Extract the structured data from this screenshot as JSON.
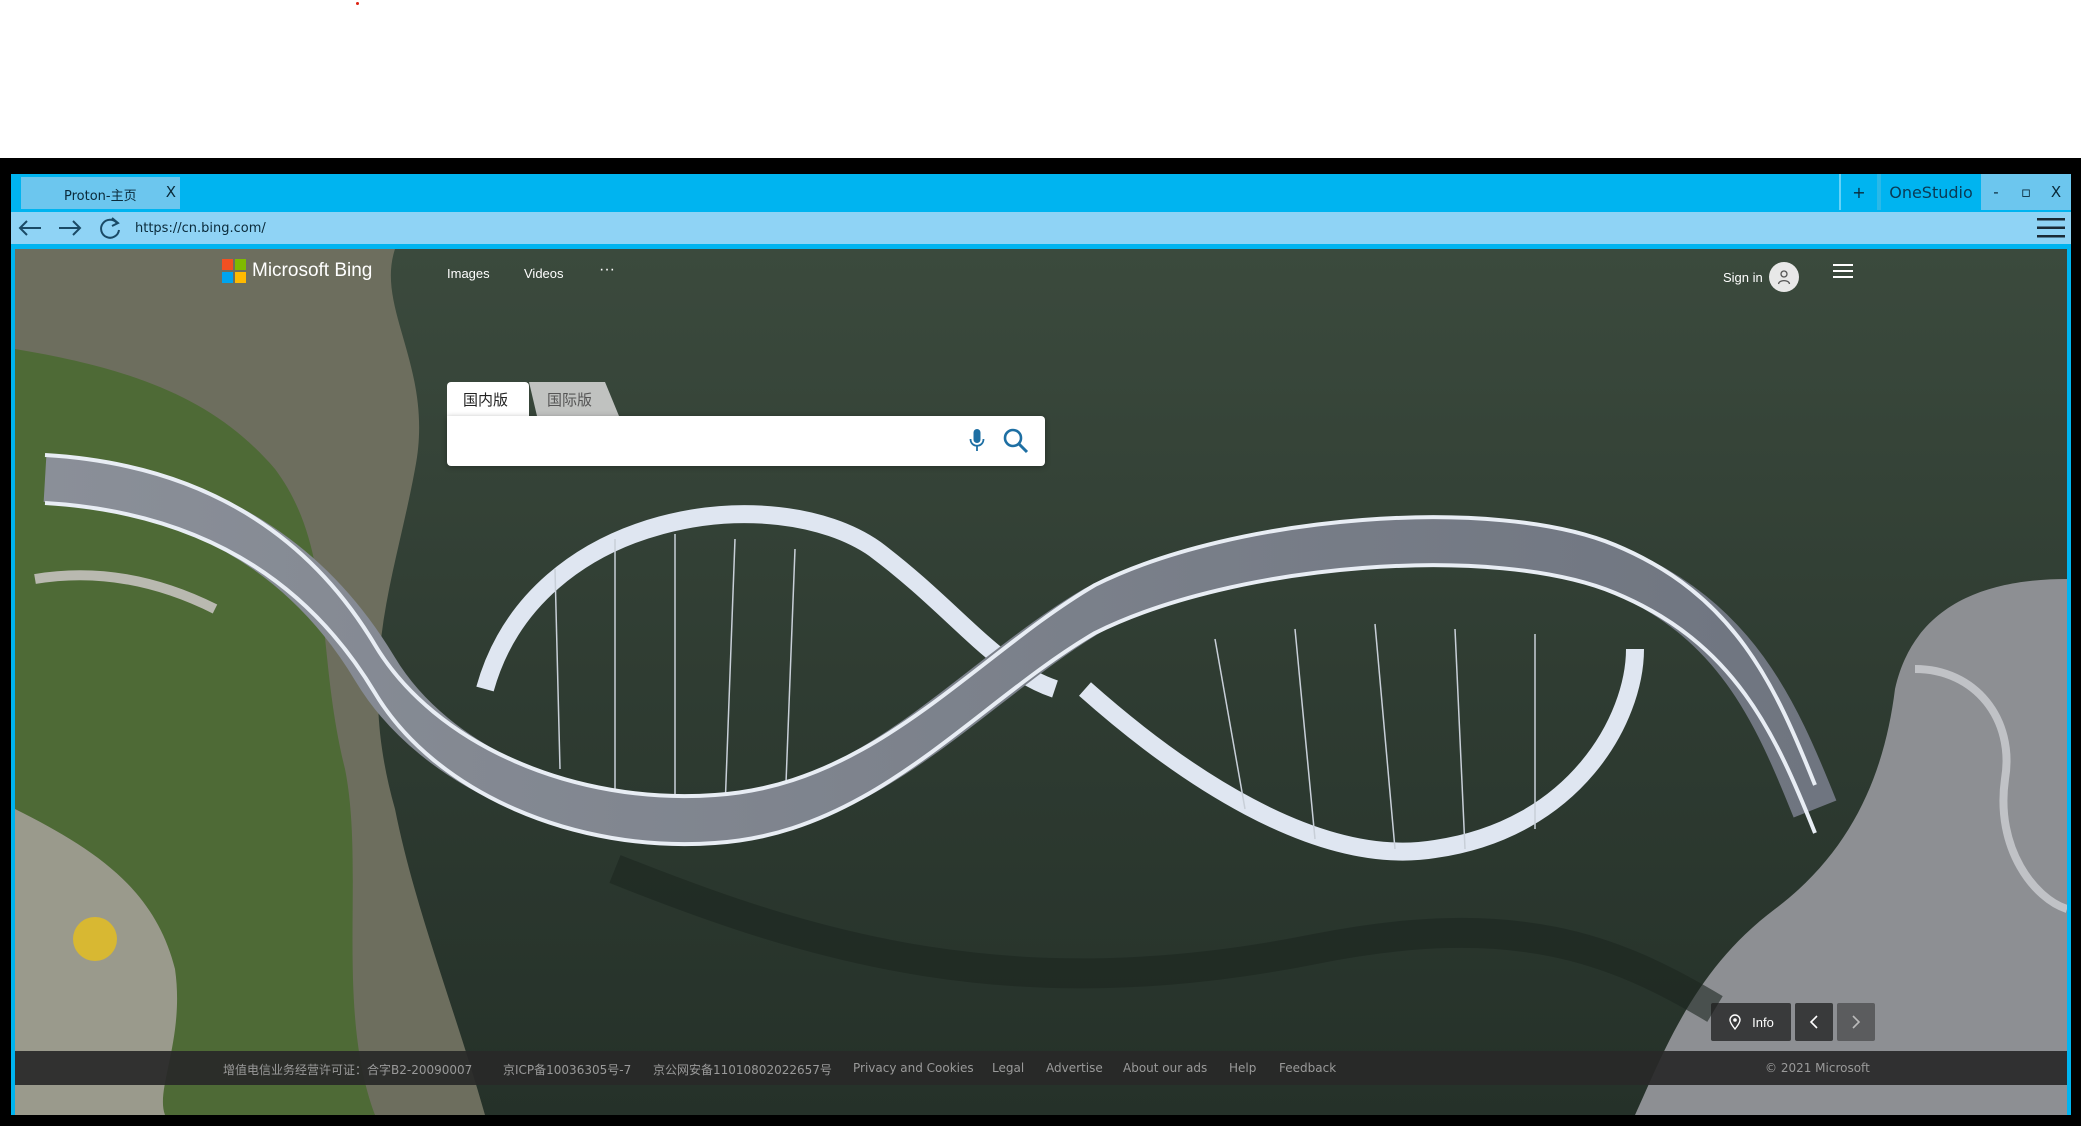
{
  "browser": {
    "tab_title": "Proton-主页",
    "tab_close": "X",
    "new_tab": "+",
    "brand": "OneStudio",
    "minimize": "-",
    "restore": "▫",
    "close": "X",
    "url": "https://cn.bing.com/"
  },
  "bing": {
    "logo_text": "Microsoft Bing",
    "nav": [
      "Images",
      "Videos",
      "···"
    ],
    "sign_in": "Sign in",
    "search_tabs": [
      "国内版",
      "国际版"
    ],
    "search_placeholder": "",
    "info": "Info"
  },
  "footer": {
    "links": [
      "增值电信业务经营许可证：合字B2-20090007",
      "京ICP备10036305号-7",
      "京公网安备11010802022657号",
      "Privacy and Cookies",
      "Legal",
      "Advertise",
      "About our ads",
      "Help",
      "Feedback"
    ],
    "copyright": "© 2021 Microsoft"
  },
  "colors": {
    "window_chrome": "#00b4f0",
    "address_bar": "#8fd3f5",
    "tab_active": "#6cc6ee"
  },
  "icons": [
    "back-arrow-icon",
    "forward-arrow-icon",
    "refresh-icon",
    "hamburger-menu-icon",
    "microphone-icon",
    "search-icon",
    "user-icon",
    "location-pin-icon",
    "chevron-left-icon",
    "chevron-right-icon"
  ]
}
